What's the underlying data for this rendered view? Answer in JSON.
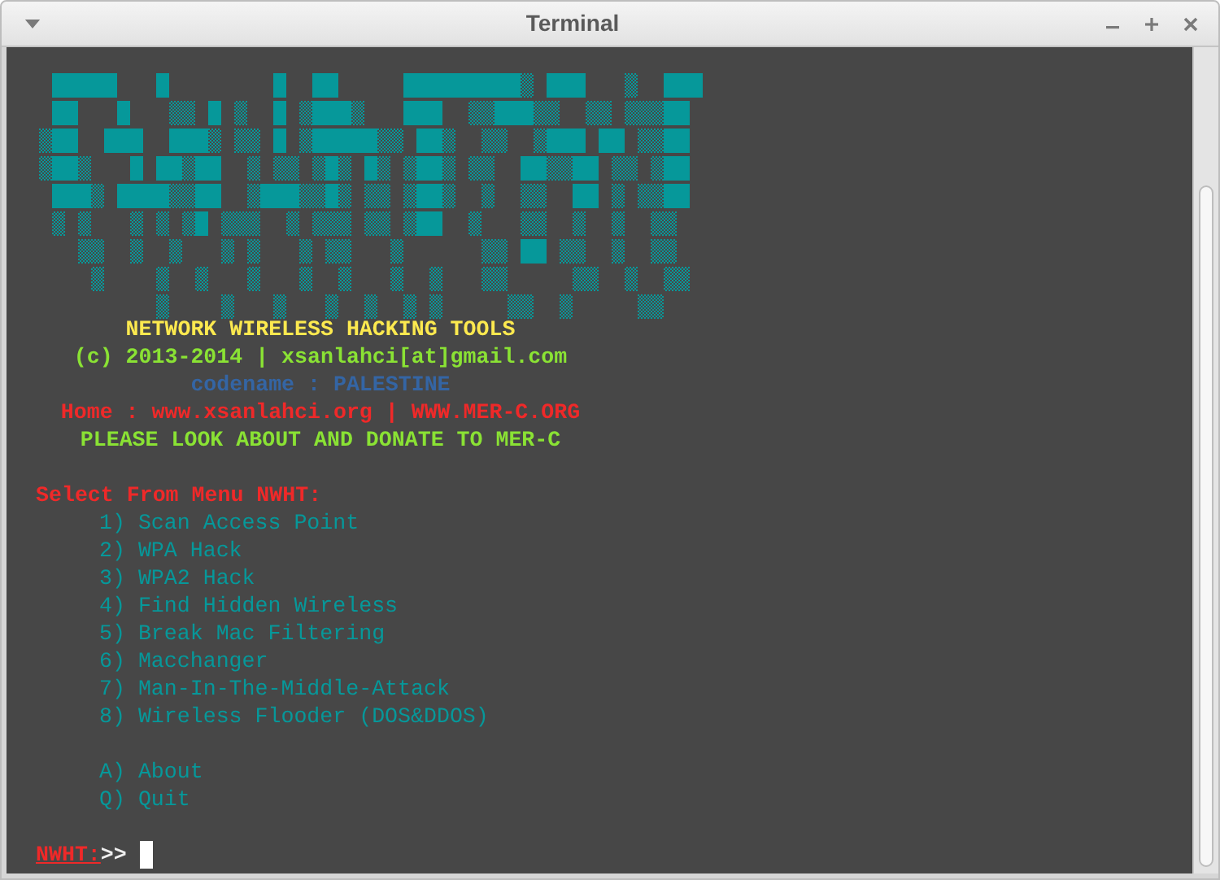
{
  "window": {
    "title": "Terminal"
  },
  "banner": [
    {
      "text": "NETWORK WIRELESS HACKING TOOLS",
      "color": "#fce94f"
    },
    {
      "text": "(c) 2013-2014 | xsanlahci[at]gmail.com",
      "color": "#8ae234"
    },
    {
      "text": "codename : PALESTINE",
      "color": "#3465a4"
    },
    {
      "text": "Home : www.xsanlahci.org | WWW.MER-C.ORG",
      "color": "#ef2929"
    },
    {
      "text": "PLEASE LOOK ABOUT AND DONATE TO MER-C",
      "color": "#8ae234"
    }
  ],
  "menu": {
    "heading": "Select From Menu NWHT:",
    "items": [
      "1) Scan Access Point",
      "2) WPA Hack",
      "3) WPA2 Hack",
      "4) Find Hidden Wireless",
      "5) Break Mac Filtering",
      "6) Macchanger",
      "7) Man-In-The-Middle-Attack",
      "8) Wireless Flooder (DOS&DDOS)"
    ],
    "extra": [
      "A) About",
      "Q) Quit"
    ]
  },
  "prompt": {
    "label": "NWHT:",
    "symbol": ">>"
  }
}
